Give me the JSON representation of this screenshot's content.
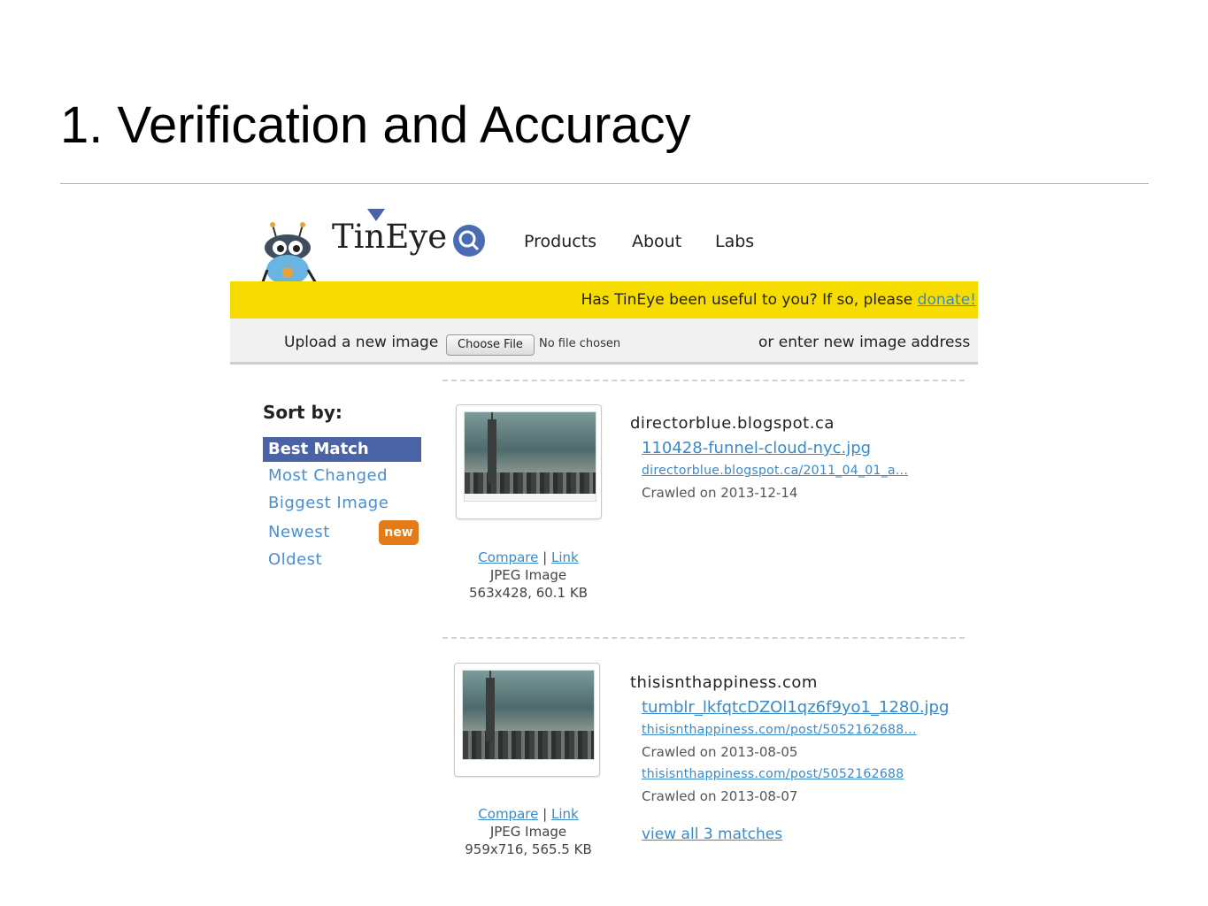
{
  "slide": {
    "title": "1. Verification and Accuracy"
  },
  "header": {
    "logo_text": "TinEye",
    "nav": [
      "Products",
      "About",
      "Labs"
    ]
  },
  "donate_bar": {
    "text": "Has TinEye been useful to you? If so, please ",
    "link": "donate!"
  },
  "upload": {
    "label": "Upload a new image",
    "button": "Choose File",
    "status": "No file chosen",
    "address_label": "or enter new image address"
  },
  "sort": {
    "title": "Sort by:",
    "active": "Best Match",
    "items": [
      "Most Changed",
      "Biggest Image",
      "Newest",
      "Oldest"
    ],
    "badge": "new"
  },
  "results": [
    {
      "compare": "Compare",
      "sep": "|",
      "link": "Link",
      "type": "JPEG Image",
      "size": "563x428, 60.1 KB",
      "site": "directorblue.blogspot.ca",
      "file": "110428-funnel-cloud-nyc.jpg",
      "url": "directorblue.blogspot.ca/2011_04_01_a...",
      "crawled": "Crawled on 2013-12-14"
    },
    {
      "compare": "Compare",
      "sep": "|",
      "link": "Link",
      "type": "JPEG Image",
      "size": "959x716, 565.5 KB",
      "site": "thisisnthappiness.com",
      "file": "tumblr_lkfqtcDZOl1qz6f9yo1_1280.jpg",
      "url": "thisisnthappiness.com/post/5052162688...",
      "crawled": "Crawled on 2013-08-05",
      "url2": "thisisnthappiness.com/post/5052162688",
      "crawled2": "Crawled on 2013-08-07",
      "view_all": "view all 3 matches"
    }
  ]
}
